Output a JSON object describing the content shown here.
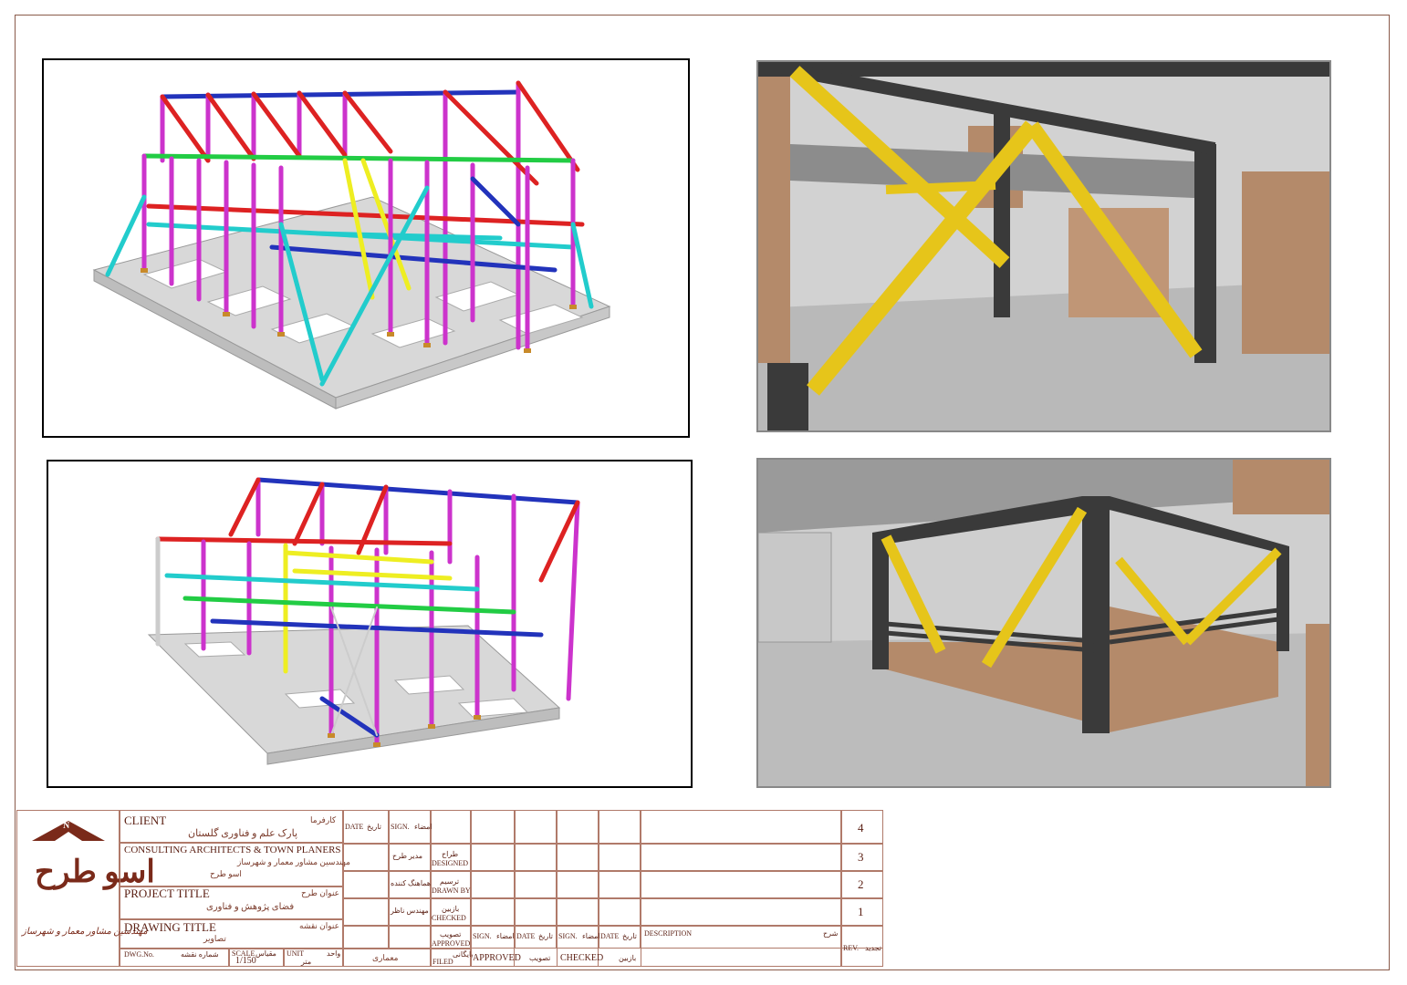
{
  "title_block": {
    "client_en": "CLIENT",
    "client_fa": "کارفرما",
    "client_value": "پارک علم و فناوری گلستان",
    "consultant_en": "CONSULTING ARCHITECTS & TOWN PLANERS",
    "consultant_fa": "مهندسین مشاور معمار و شهرساز",
    "consultant_value": "اسو طرح",
    "project_en": "PROJECT TITLE",
    "project_fa": "عنوان طرح",
    "project_value": "فضای پژوهش و فناوری",
    "drawing_en": "DRAWING TITLE",
    "drawing_fa": "عنوان نقشه",
    "drawing_value": "تصاویر",
    "date_label": "DATE",
    "date_fa": "تاریخ",
    "sign_label": "SIGN.",
    "sign_fa": "امضاء",
    "designed_en": "DESIGNED",
    "designed_fa": "طراح",
    "designer_fa": "مدیر طرح",
    "drawn_en": "DRAWN BY",
    "drawn_fa": "ترسیم",
    "drafter_fa": "هماهنگ کننده",
    "checked_en": "CHECKED",
    "checked_fa": "بازبین",
    "checker_fa": "مهندس ناظر",
    "approved_en": "APPROVED",
    "approved_fa": "تصویب",
    "filed_en": "FILED",
    "filed_fa": "بایگانی",
    "dwg_no_en": "DWG.No.",
    "dwg_no_fa": "شماره نقشه",
    "scale_en": "SCALE",
    "scale_fa": "مقیاس",
    "scale_value": "1/150",
    "unit_en": "UNIT",
    "unit_fa": "واحد",
    "unit_value": "متر",
    "discipline_value": "معماری",
    "description_en": "DESCRIPTION",
    "description_fa": "شرح",
    "rev_en": "REV.",
    "rev_fa": "تجدید",
    "approved_bottom": "APPROVED",
    "checked_bottom": "CHECKED",
    "revisions": [
      "4",
      "3",
      "2",
      "1"
    ]
  },
  "logo": {
    "mark": "N",
    "name_fa": "اسو طرح",
    "tagline_fa": "مهندسین مشاور معمار و شهرساز"
  },
  "colors": {
    "brand": "#7a2a1a",
    "frame": "#8a5a4a",
    "steel_column": "#cc33cc",
    "steel_beam_red": "#dd2222",
    "steel_beam_blue": "#2233bb",
    "steel_beam_green": "#22cc44",
    "steel_beam_yellow": "#eeee22",
    "steel_brace_cyan": "#22cccc",
    "render_brace": "#e6c51a",
    "render_steel": "#3a3a3a",
    "render_brick": "#b48a6a"
  }
}
